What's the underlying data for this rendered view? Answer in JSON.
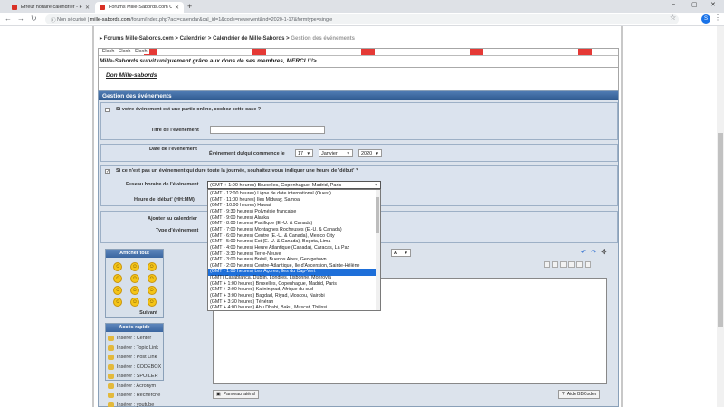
{
  "browser": {
    "tabs": [
      {
        "title": "Erreur horaire calendrier - Forum"
      },
      {
        "title": "Forums Mille-Sabords.com Calen"
      }
    ],
    "new_tab_symbol": "+",
    "window_controls": {
      "minimize": "–",
      "maximize": "▢",
      "close": "✕"
    },
    "security_label": "Non sécurisé",
    "url_host": "mille-sabords.com",
    "url_path": "/forum/index.php?act=calendar&cal_id=1&code=newevent&nd=2020-1-17&formtype=single",
    "profile_initial": "S"
  },
  "breadcrumb": {
    "prefix": "▸",
    "items": [
      "Forums Mille-Sabords.com",
      "Calendrier",
      "Calendrier de Mille-Sabords"
    ],
    "separator": ">",
    "current": "Gestion des événements"
  },
  "flash": {
    "label": "Flash...Flash...Flash",
    "message": "Mille-Sabords survit uniquement grâce aux dons de ses membres, MERCI !!!>",
    "donation_link": "Don Mille-sabords"
  },
  "form": {
    "header": "Gestion des événements",
    "online_checkbox_label": "Si votre événement est une partie online, cochez cette case ?",
    "title_label": "Titre de l'événement",
    "title_value": "",
    "date_label": "Date de l'événement",
    "date_prefix": "Événement du/qui commence le",
    "day": "17",
    "month": "Janvier",
    "year": "2020",
    "allday_checkbox_label": "Si ce n'est pas un événement qui dure toute la journée, souhaitez-vous indiquer une heure de 'début' ?",
    "timezone_label": "Fuseau horaire de l'événement",
    "timezone_value": "(GMT + 1:00 heures) Bruxelles, Copenhague, Madrid, Paris",
    "start_time_label": "Heure de 'début' (HH:MM)",
    "add_calendar_label": "Ajouter au calendrier",
    "type_label": "Type d'événement"
  },
  "timezone_options": [
    "(GMT - 12:00 heures) Ligne de date international (Ouest)",
    "(GMT - 11:00 heures) Îles Midway, Samoa",
    "(GMT - 10:00 heures) Hawaii",
    "(GMT - 9:30 heures) Polynésie française",
    "(GMT - 9:00 heures) Alaska",
    "(GMT - 8:00 heures) Pacifique (É.-U. & Canada)",
    "(GMT - 7:00 heures) Montagnes Rocheuses (É.-U. & Canada)",
    "(GMT - 6:00 heures) Centre (É.-U. & Canada), Mexico City",
    "(GMT - 5:00 heures) Est (É.-U. & Canada), Bogota, Lima",
    "(GMT - 4:00 heures) Heure Atlantique (Canada), Caracas, La Paz",
    "(GMT - 3:30 heures) Terre-Neuve",
    "(GMT - 3:00 heures) Brésil, Buenos Aires, Georgetown",
    "(GMT - 2:00 heures) Centre-Atlantique, Île d'Ascension, Sainte-Hélène",
    "(GMT - 1:00 heures) Les Açores, Îles du Cap-Vert",
    "(GMT) Casablanca, Dublin, Londres, Lisbonne, Monrovia",
    "(GMT + 1:00 heures) Bruxelles, Copenhague, Madrid, Paris",
    "(GMT + 2:00 heures) Kaliningrad, Afrique du sud",
    "(GMT + 3:00 heures) Bagdad, Riyad, Moscou, Nairobi",
    "(GMT + 3:30 heures) Téhéran",
    "(GMT + 4:00 heures) Abu Dhabi, Baku, Muscat, Tbilissi"
  ],
  "highlighted_option_index": 13,
  "smilies": {
    "header": "Afficher tout",
    "next": "Suivant",
    "faces": [
      "☺",
      "☺",
      "☺",
      "☺",
      "☺",
      "☺",
      "☺",
      "☺",
      "☺",
      "☺",
      "☺",
      "☺"
    ]
  },
  "quick_access": {
    "header": "Accès rapide",
    "items": [
      "Insérer : Center",
      "Insérer : Topic Link",
      "Insérer : Post Link",
      "Insérer : CODEBOX",
      "Insérer : SPOILER",
      "Insérer : Acronym",
      "Insérer : Recherche",
      "Insérer : youtube"
    ]
  },
  "editor": {
    "font_color_glyph": "A",
    "side_panel_button": "Panneau latéral",
    "bbcode_help_button": "Aide BBCodes"
  },
  "colors": {
    "header_blue": "#2f5a90",
    "panel_bg": "#dbe3ee",
    "highlight": "#1e6fd9"
  }
}
